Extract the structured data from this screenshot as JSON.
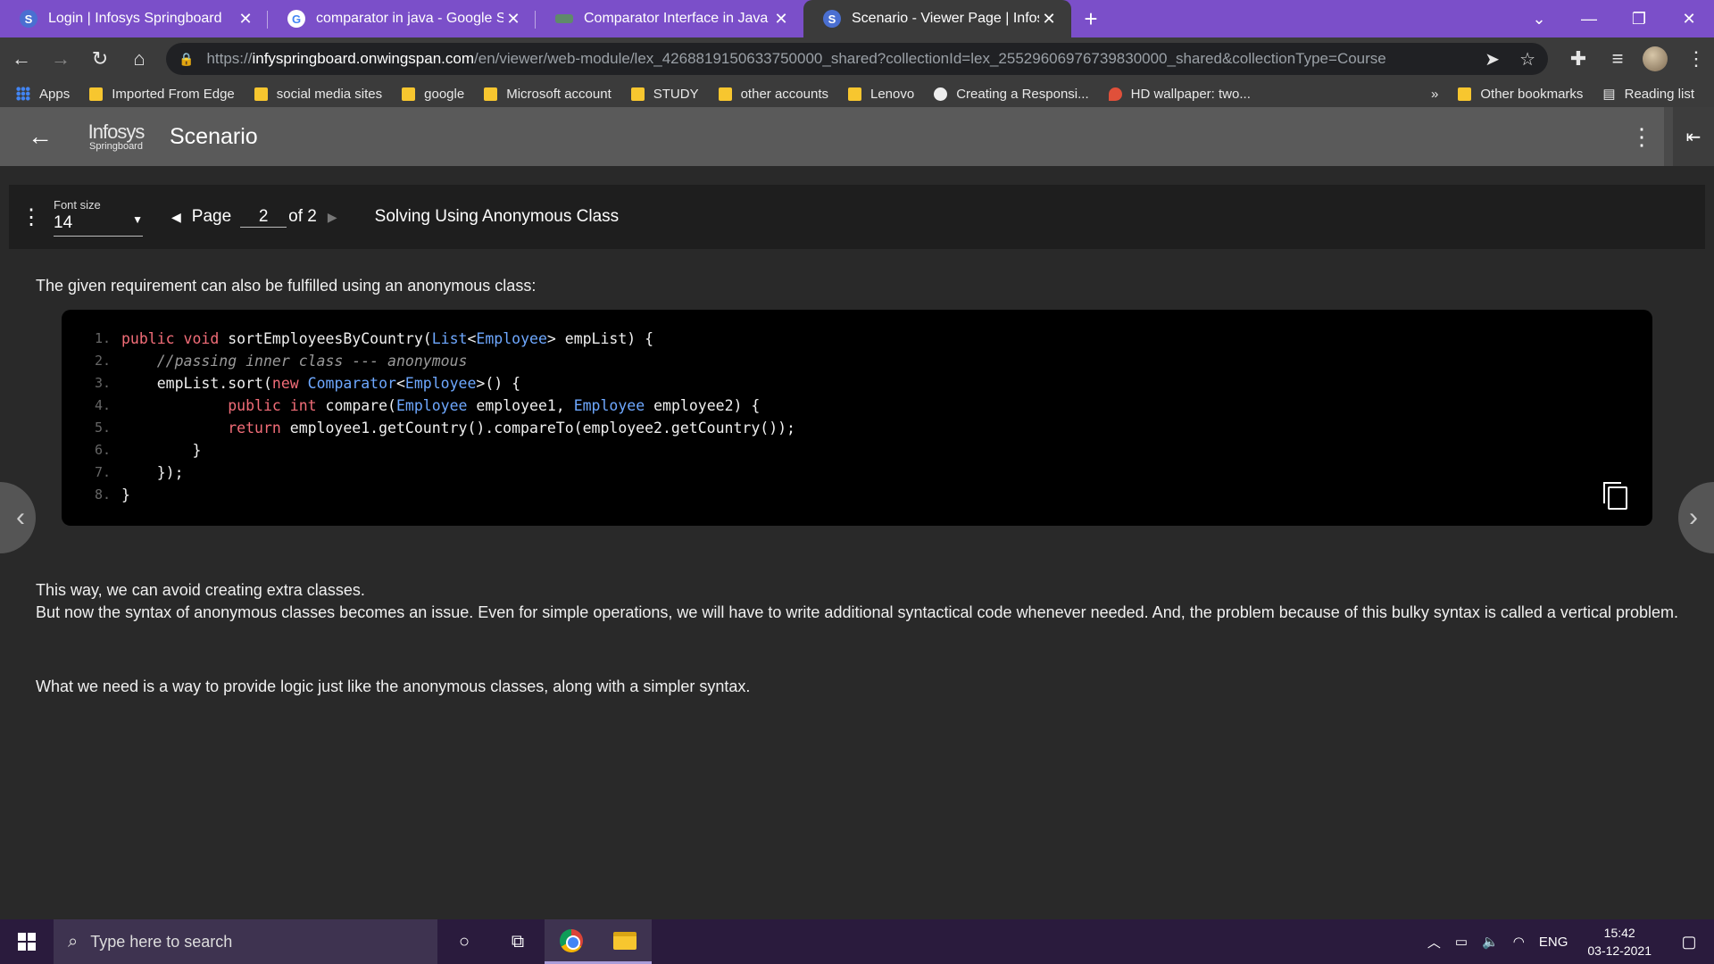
{
  "browser": {
    "tabs": [
      {
        "title": "Login | Infosys Springboard",
        "favicon": "springboard-icon",
        "active": false
      },
      {
        "title": "comparator in java - Google Sear",
        "favicon": "google-icon",
        "active": false
      },
      {
        "title": "Comparator Interface in Java with",
        "favicon": "page-icon",
        "active": false
      },
      {
        "title": "Scenario - Viewer Page | Infosys S",
        "favicon": "springboard-icon",
        "active": true
      }
    ],
    "url_host": "infyspringboard.onwingspan.com",
    "url_scheme": "https://",
    "url_path": "/en/viewer/web-module/lex_4268819150633750000_shared?collectionId=lex_25529606976739830000_shared&collectionType=Course",
    "bookmarks": [
      {
        "label": "Apps",
        "icon": "apps-grid-icon"
      },
      {
        "label": "Imported From Edge",
        "icon": "folder-icon"
      },
      {
        "label": "social media sites",
        "icon": "folder-icon"
      },
      {
        "label": "google",
        "icon": "folder-icon"
      },
      {
        "label": "Microsoft account",
        "icon": "folder-icon"
      },
      {
        "label": "STUDY",
        "icon": "folder-icon"
      },
      {
        "label": "other accounts",
        "icon": "folder-icon"
      },
      {
        "label": "Lenovo",
        "icon": "folder-icon"
      },
      {
        "label": "Creating a Responsi...",
        "icon": "site-icon"
      },
      {
        "label": "HD wallpaper: two...",
        "icon": "site-icon"
      }
    ],
    "bookmarks_more": "»",
    "other_bookmarks": "Other bookmarks",
    "reading_list": "Reading list"
  },
  "app": {
    "logo_line1": "Infosys",
    "logo_line2": "Springboard",
    "title": "Scenario"
  },
  "viewer": {
    "font_size_label": "Font size",
    "font_size_value": "14",
    "page_label": "Page",
    "page_current": "2",
    "page_total_label": "of 2",
    "doc_title": "Solving Using Anonymous Class"
  },
  "content": {
    "intro": "The given requirement can also be fulfilled using an anonymous class:",
    "line_numbers": [
      "1.",
      "2.",
      "3.",
      "4.",
      "5.",
      "6.",
      "7.",
      "8."
    ],
    "para2_line1": "This way, we can avoid creating extra classes.",
    "para2_line2": "But now the syntax of anonymous classes becomes an issue. Even for simple operations, we will have to write additional syntactical code whenever needed. And, the problem because of this bulky syntax is called a vertical problem.",
    "para3": "What we need is a way to provide logic just like the anonymous classes, along with a simpler syntax."
  },
  "taskbar": {
    "search_placeholder": "Type here to search",
    "language": "ENG",
    "time": "15:42",
    "date": "03-12-2021"
  },
  "colors": {
    "tabstrip": "#7b4fc9",
    "keyword": "#f26d78",
    "type": "#6ea8ff"
  }
}
